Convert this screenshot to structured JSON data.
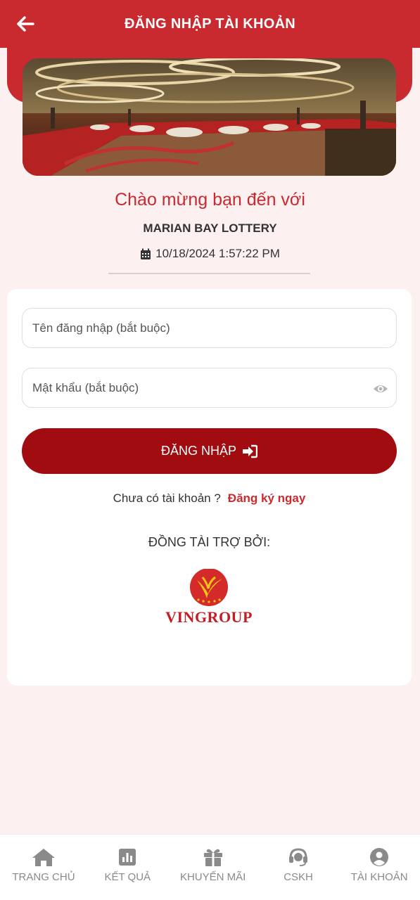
{
  "header": {
    "title": "ĐĂNG NHẬP TÀI KHOẢN",
    "back_icon": "arrow-left-icon",
    "color": "#c92a2f"
  },
  "welcome": {
    "greeting": "Chào mừng bạn đến với",
    "brand": "MARIAN BAY LOTTERY",
    "datetime": "10/18/2024 1:57:22 PM",
    "calendar_icon": "calendar-icon"
  },
  "form": {
    "username_placeholder": "Tên đăng nhập (bắt buộc)",
    "username_value": "",
    "password_placeholder": "Mật khẩu (bắt buộc)",
    "password_value": "",
    "login_label": "ĐĂNG NHẬP",
    "login_color": "#a10c10",
    "no_account_text": "Chưa có tài khoản ?",
    "register_link": "Đăng ký ngay"
  },
  "sponsor": {
    "title": "ĐỒNG TÀI TRỢ BỞI:",
    "logo_text": "VINGROUP"
  },
  "bottom_nav": {
    "items": [
      {
        "label": "TRANG CHỦ",
        "icon": "home-icon"
      },
      {
        "label": "KẾT QUẢ",
        "icon": "chart-icon"
      },
      {
        "label": "KHUYẾN MÃI",
        "icon": "gift-icon"
      },
      {
        "label": "CSKH",
        "icon": "headset-icon"
      },
      {
        "label": "TÀI KHOẢN",
        "icon": "user-icon"
      }
    ]
  }
}
